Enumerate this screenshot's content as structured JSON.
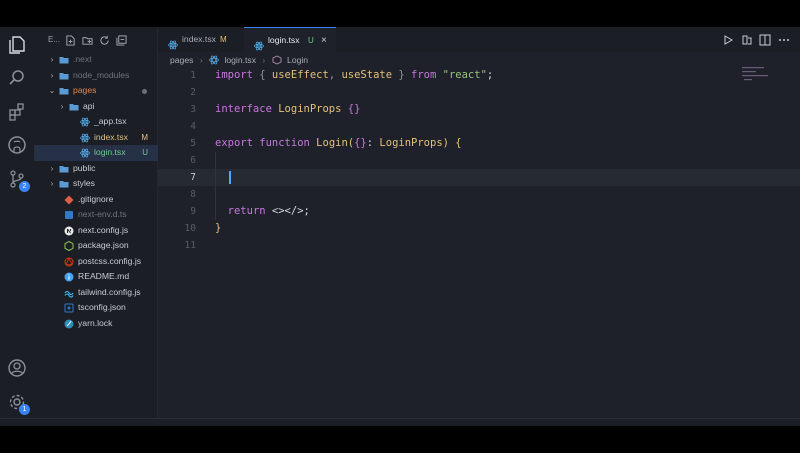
{
  "sidebar": {
    "title": "E...",
    "items": [
      {
        "label": ".next",
        "type": "folder",
        "state": "collapsed",
        "dim": true
      },
      {
        "label": "node_modules",
        "type": "folder",
        "state": "collapsed",
        "dim": true
      },
      {
        "label": "pages",
        "type": "folder",
        "state": "expanded",
        "color": "#e0884e",
        "modified_dot": true
      },
      {
        "label": "api",
        "type": "folder",
        "state": "collapsed"
      },
      {
        "label": "_app.tsx",
        "type": "react"
      },
      {
        "label": "index.tsx",
        "type": "react",
        "status": "M",
        "color": "#e5c07b"
      },
      {
        "label": "login.tsx",
        "type": "react",
        "status": "U",
        "color": "#73c991",
        "active": true
      },
      {
        "label": "public",
        "type": "folder",
        "state": "collapsed"
      },
      {
        "label": "styles",
        "type": "folder",
        "state": "collapsed"
      },
      {
        "label": ".gitignore",
        "type": "git"
      },
      {
        "label": "next-env.d.ts",
        "type": "ts",
        "dim": true
      },
      {
        "label": "next.config.js",
        "type": "next"
      },
      {
        "label": "package.json",
        "type": "npm"
      },
      {
        "label": "postcss.config.js",
        "type": "postcss"
      },
      {
        "label": "README.md",
        "type": "info"
      },
      {
        "label": "tailwind.config.js",
        "type": "tailwind"
      },
      {
        "label": "tsconfig.json",
        "type": "tsconfig"
      },
      {
        "label": "yarn.lock",
        "type": "yarn"
      }
    ]
  },
  "activity": {
    "source_control_badge": "2",
    "settings_badge": "1"
  },
  "tabs": [
    {
      "label": "index.tsx",
      "status": "M"
    },
    {
      "label": "login.tsx",
      "status": "U",
      "close": "×"
    }
  ],
  "breadcrumb": {
    "folder": "pages",
    "file": "login.tsx",
    "symbol": "Login",
    "sep": "›"
  },
  "editor": {
    "current_line": 7,
    "lines": [
      {
        "n": "1",
        "tokens": [
          [
            "kw",
            "import"
          ],
          [
            "punc",
            " { "
          ],
          [
            "fn",
            "useEffect"
          ],
          [
            "punc",
            ", "
          ],
          [
            "fn",
            "useState"
          ],
          [
            "punc",
            " } "
          ],
          [
            "kw",
            "from"
          ],
          [
            "plain",
            " "
          ],
          [
            "str",
            "\"react\""
          ],
          [
            "plain",
            ";"
          ]
        ]
      },
      {
        "n": "2",
        "tokens": []
      },
      {
        "n": "3",
        "tokens": [
          [
            "kw",
            "interface"
          ],
          [
            "plain",
            " "
          ],
          [
            "ty",
            "LoginProps"
          ],
          [
            "plain",
            " "
          ],
          [
            "pb",
            "{}"
          ]
        ]
      },
      {
        "n": "4",
        "tokens": []
      },
      {
        "n": "5",
        "tokens": [
          [
            "kw",
            "export"
          ],
          [
            "plain",
            " "
          ],
          [
            "kw",
            "function"
          ],
          [
            "plain",
            " "
          ],
          [
            "fn",
            "Login"
          ],
          [
            "brace",
            "("
          ],
          [
            "pb",
            "{}"
          ],
          [
            "plain",
            ": "
          ],
          [
            "ty",
            "LoginProps"
          ],
          [
            "brace",
            ")"
          ],
          [
            "plain",
            " "
          ],
          [
            "brace",
            "{"
          ]
        ]
      },
      {
        "n": "6",
        "tokens": []
      },
      {
        "n": "7",
        "tokens": []
      },
      {
        "n": "8",
        "tokens": []
      },
      {
        "n": "9",
        "tokens": [
          [
            "plain",
            "  "
          ],
          [
            "kw",
            "return"
          ],
          [
            "plain",
            " <></>;"
          ]
        ]
      },
      {
        "n": "10",
        "tokens": [
          [
            "brace",
            "}"
          ]
        ]
      },
      {
        "n": "11",
        "tokens": []
      }
    ]
  },
  "colors": {
    "accent": "#3b82f6",
    "background": "#1e2129",
    "sidebar": "#1b1e25"
  }
}
